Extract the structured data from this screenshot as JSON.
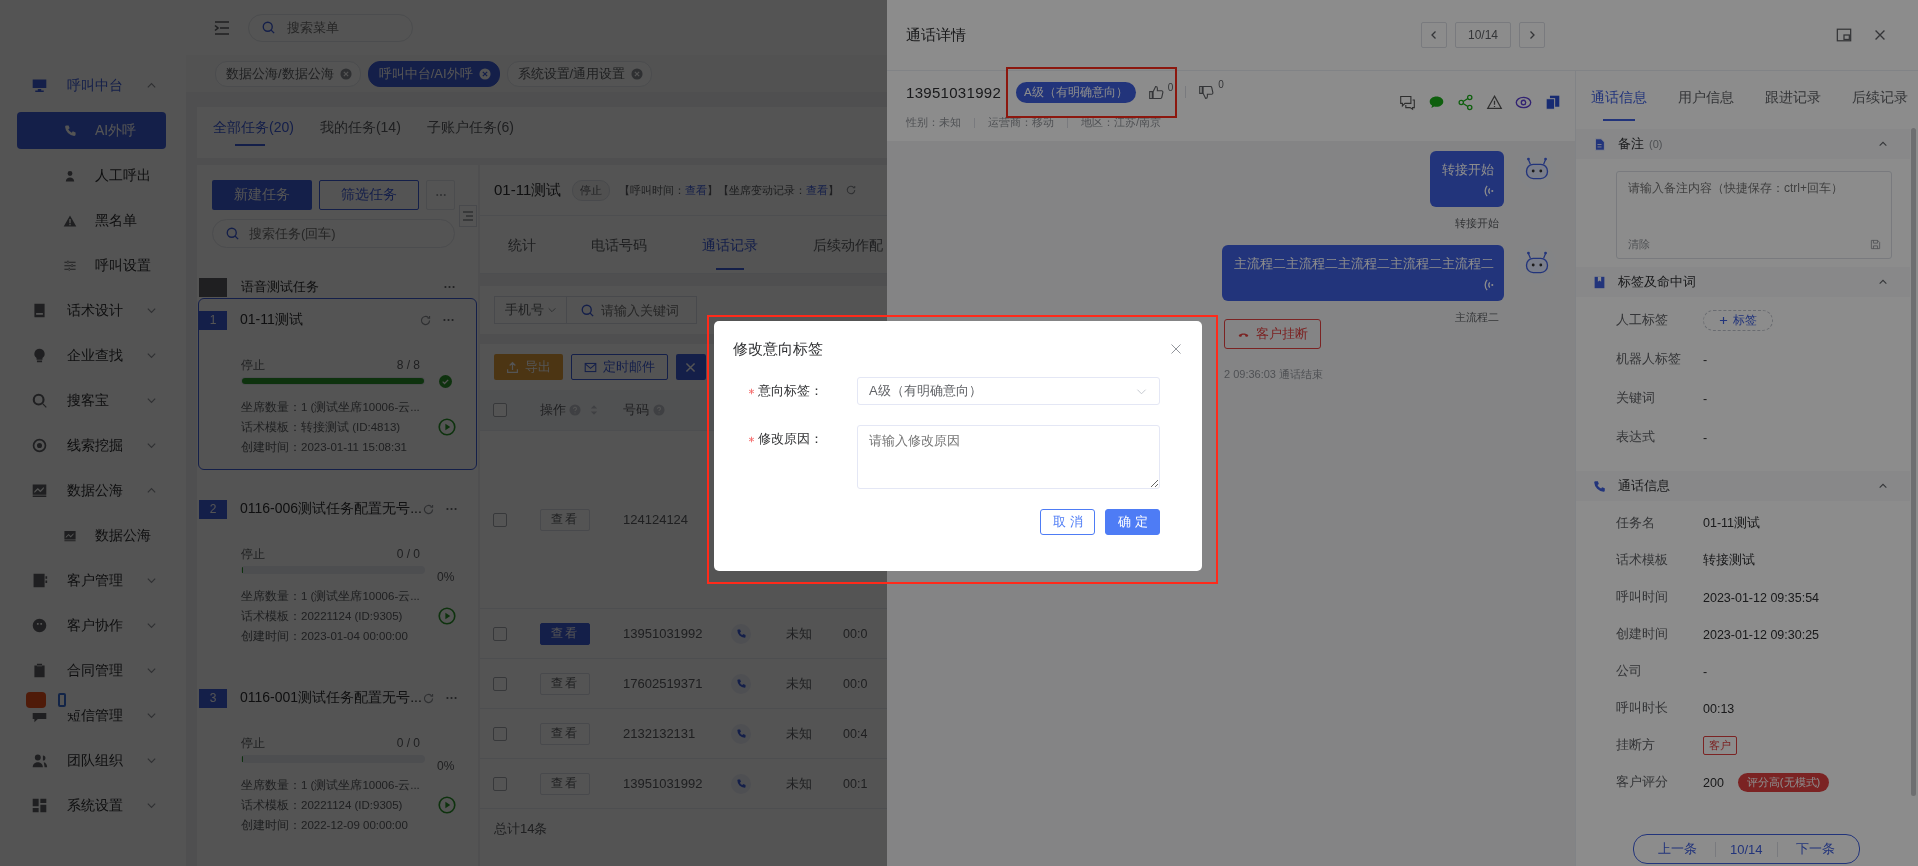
{
  "sidebar": {
    "items": [
      {
        "label": "呼叫中台",
        "active": true,
        "expanded": true,
        "children": [
          {
            "label": "AI外呼",
            "selected": true
          },
          {
            "label": "人工呼出",
            "selected": false
          },
          {
            "label": "黑名单",
            "selected": false
          },
          {
            "label": "呼叫设置",
            "selected": false
          }
        ]
      },
      {
        "label": "话术设计",
        "active": false,
        "expanded": false
      },
      {
        "label": "企业查找",
        "active": false,
        "expanded": false
      },
      {
        "label": "搜客宝",
        "active": false,
        "expanded": false
      },
      {
        "label": "线索挖掘",
        "active": false,
        "expanded": false
      },
      {
        "label": "数据公海",
        "active": false,
        "expanded": true,
        "children": [
          {
            "label": "数据公海",
            "selected": false
          }
        ]
      },
      {
        "label": "客户管理",
        "active": false,
        "expanded": false
      },
      {
        "label": "客户协作",
        "active": false,
        "expanded": false
      },
      {
        "label": "合同管理",
        "active": false,
        "expanded": false
      },
      {
        "label": "短信管理",
        "active": false,
        "expanded": false
      },
      {
        "label": "团队组织",
        "active": false,
        "expanded": false
      },
      {
        "label": "系统设置",
        "active": false,
        "expanded": false
      }
    ]
  },
  "topbar": {
    "search_placeholder": "搜索菜单"
  },
  "open_tabs": [
    {
      "label": "数据公海/数据公海",
      "selected": false
    },
    {
      "label": "呼叫中台/AI外呼",
      "selected": true
    },
    {
      "label": "系统设置/通用设置",
      "selected": false
    }
  ],
  "task_tabs": [
    {
      "label": "全部任务(20)",
      "selected": true
    },
    {
      "label": "我的任务(14)",
      "selected": false
    },
    {
      "label": "子账户任务(6)",
      "selected": false
    }
  ],
  "task_list": {
    "new_button": "新建任务",
    "filter_button": "筛选任务",
    "search_placeholder": "搜索任务(回车)",
    "group": "语音测试任务",
    "tasks": [
      {
        "index": "1",
        "title": "01-11测试",
        "selected": true,
        "status": "停止",
        "count": "8 / 8",
        "level": 1,
        "done": true,
        "seats": "坐席数量：1 (测试坐席10006-云...",
        "template": "话术模板：转接测试 (ID:4813)",
        "created": "创建时间：2023-01-11 15:08:31"
      },
      {
        "index": "2",
        "title": "0116-006测试任务配置无号...",
        "selected": false,
        "status": "停止",
        "count": "0 / 0",
        "level": 0,
        "done": false,
        "percent": "0%",
        "seats": "坐席数量：1 (测试坐席10006-云...",
        "template": "话术模板：20221124 (ID:9305)",
        "created": "创建时间：2023-01-04 00:00:00"
      },
      {
        "index": "3",
        "title": "0116-001测试任务配置无号...",
        "selected": false,
        "status": "停止",
        "count": "0 / 0",
        "level": 0,
        "done": false,
        "percent": "0%",
        "seats": "坐席数量：1 (测试坐席10006-云...",
        "template": "话术模板：20221124 (ID:9305)",
        "created": "创建时间：2022-12-09 00:00:00"
      }
    ]
  },
  "task_detail": {
    "title": "01-11测试",
    "status": "停止",
    "info": [
      {
        "label": "【呼叫时间：",
        "link": "查看"
      },
      {
        "label": "】【坐席变动记录：",
        "link": "查看"
      }
    ],
    "info_end": "】",
    "tabs": [
      {
        "label": "统计",
        "selected": false
      },
      {
        "label": "电话号码",
        "selected": false
      },
      {
        "label": "通话记录",
        "selected": true
      },
      {
        "label": "后续动作配",
        "selected": false
      }
    ],
    "filter": {
      "select": "手机号",
      "search_placeholder": "请输入关键词"
    },
    "toolbar": [
      {
        "kind": "export",
        "label": "导出"
      },
      {
        "kind": "mail",
        "label": "定时邮件"
      },
      {
        "kind": "batch"
      }
    ],
    "table": {
      "header_checked": false,
      "columns": [
        "操作",
        "号码"
      ],
      "rows": [
        {
          "checked": false,
          "action": "查看",
          "current": false,
          "number": "124124124"
        },
        {
          "checked": false,
          "action": "查看",
          "current": true,
          "number": "13951031992",
          "gender": "未知",
          "duration": "00:0"
        },
        {
          "checked": false,
          "action": "查看",
          "current": false,
          "number": "17602519371",
          "gender": "未知",
          "duration": "00:0"
        },
        {
          "checked": false,
          "action": "查看",
          "current": false,
          "number": "2132132131",
          "gender": "未知",
          "duration": "00:4"
        },
        {
          "checked": false,
          "action": "查看",
          "current": false,
          "number": "13951031992",
          "gender": "未知",
          "duration": "00:1"
        }
      ],
      "total": "总计14条"
    }
  },
  "drawer": {
    "title": "通话详情",
    "position": "10/14",
    "phone": "13951031992",
    "intent_tag": "A级（有明确意向）",
    "likes": "0",
    "dislikes": "0",
    "meta": [
      "性别：未知",
      "运营商：移动",
      "地区：江苏/南京"
    ],
    "messages": [
      {
        "text": "转接开始",
        "caption": "转接开始"
      },
      {
        "text": "主流程二主流程二主流程二主流程二主流程二",
        "caption": "主流程二"
      }
    ],
    "hangup": "客户挂断",
    "end_note": "2 09:36:03 通话结束"
  },
  "info_panel": {
    "tabs": [
      {
        "label": "通话信息",
        "selected": true
      },
      {
        "label": "用户信息",
        "selected": false
      },
      {
        "label": "跟进记录",
        "selected": false
      },
      {
        "label": "后续记录",
        "selected": false
      }
    ],
    "note": {
      "title": "备注",
      "count": "(0)",
      "expanded": true,
      "placeholder": "请输入备注内容（快捷保存：ctrl+回车）",
      "clear": "清除"
    },
    "tags": {
      "title": "标签及命中词",
      "expanded": true,
      "rows": [
        {
          "kind": "add",
          "label": "人工标签",
          "value": "标签"
        },
        {
          "kind": "text",
          "label": "机器人标签",
          "value": "-"
        },
        {
          "kind": "text",
          "label": "关键词",
          "value": "-"
        },
        {
          "kind": "text",
          "label": "表达式",
          "value": "-"
        }
      ]
    },
    "call": {
      "title": "通话信息",
      "expanded": true,
      "rows": [
        {
          "kind": "text",
          "label": "任务名",
          "value": "01-11测试"
        },
        {
          "kind": "text",
          "label": "话术模板",
          "value": "转接测试"
        },
        {
          "kind": "text",
          "label": "呼叫时间",
          "value": "2023-01-12 09:35:54"
        },
        {
          "kind": "text",
          "label": "创建时间",
          "value": "2023-01-12 09:30:25"
        },
        {
          "kind": "text",
          "label": "公司",
          "value": "-"
        },
        {
          "kind": "text",
          "label": "呼叫时长",
          "value": "00:13"
        },
        {
          "kind": "tag",
          "label": "挂断方",
          "value": "客户"
        },
        {
          "kind": "score",
          "label": "客户评分",
          "value": "200",
          "tag": "评分高(无模式)"
        }
      ]
    },
    "pager": {
      "prev": "上一条",
      "position": "10/14",
      "next": "下一条"
    }
  },
  "dialog": {
    "title": "修改意向标签",
    "fields": [
      {
        "kind": "select",
        "label": "意向标签：",
        "required": true,
        "value": "A级（有明确意向）"
      },
      {
        "kind": "textarea",
        "label": "修改原因：",
        "required": true,
        "placeholder": "请输入修改原因"
      }
    ],
    "cancel": "取消",
    "confirm": "确定"
  }
}
